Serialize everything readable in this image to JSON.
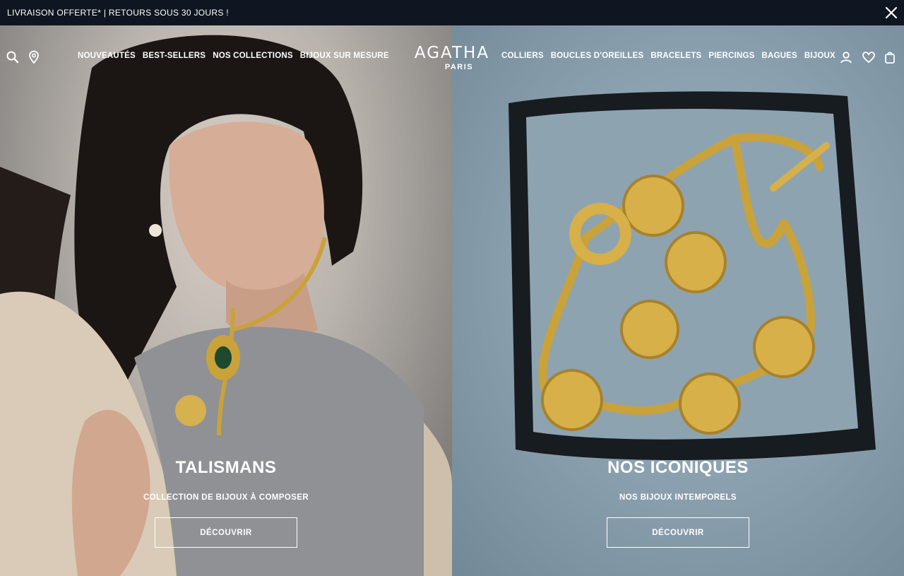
{
  "announcement": {
    "text": "LIVRAISON OFFERTE* | RETOURS SOUS 30 JOURS !"
  },
  "brand": {
    "name": "AGATHA",
    "sub": "PARIS"
  },
  "nav": {
    "left_items": [
      "NOUVEAUTÉS",
      "BEST-SELLERS",
      "NOS COLLECTIONS",
      "BIJOUX SUR MESURE"
    ],
    "right_items": [
      "COLLIERS",
      "BOUCLES D'OREILLES",
      "BRACELETS",
      "PIERCINGS",
      "BAGUES",
      "BIJOUX"
    ],
    "icons": [
      "search-icon",
      "store-locator-icon",
      "account-icon",
      "wishlist-icon",
      "bag-icon"
    ]
  },
  "panels": [
    {
      "title": "TALISMANS",
      "subtitle": "COLLECTION DE BIJOUX À COMPOSER",
      "cta": "DÉCOUVRIR"
    },
    {
      "title": "NOS ICONIQUES",
      "subtitle": "NOS BIJOUX INTEMPORELS",
      "cta": "DÉCOUVRIR"
    }
  ],
  "colors": {
    "announcement_bg": "#0f1621",
    "text_on_image": "#ffffff",
    "gold": "#c9a23a"
  }
}
